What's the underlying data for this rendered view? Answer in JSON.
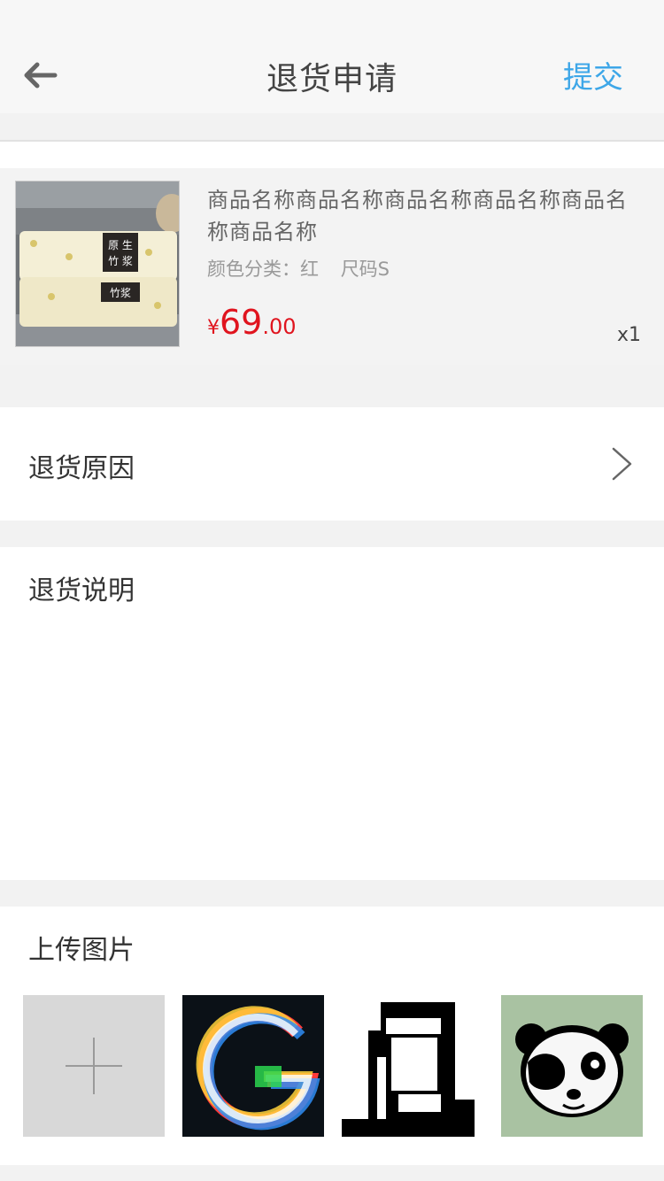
{
  "navbar": {
    "title": "退货申请",
    "submit_label": "提交",
    "back_icon": "arrow-left-icon"
  },
  "product": {
    "name": "商品名称商品名称商品名称商品名称商品名称商品名称",
    "spec_color": "颜色分类：红",
    "spec_size": "尺码S",
    "price_currency": "¥",
    "price_integer": "69",
    "price_decimal": ".00",
    "quantity": "x1",
    "thumbnail_text_1": "原 生",
    "thumbnail_text_2": "竹 浆",
    "thumbnail_text_3": "竹浆"
  },
  "reason": {
    "label": "退货原因",
    "icon": "chevron-right-icon"
  },
  "description": {
    "label": "退货说明",
    "value": "",
    "placeholder": ""
  },
  "upload": {
    "label": "上传图片",
    "add_icon": "plus-icon"
  },
  "colors": {
    "accent": "#3ea7e8",
    "price": "#e0141e",
    "background": "#f2f2f2"
  }
}
